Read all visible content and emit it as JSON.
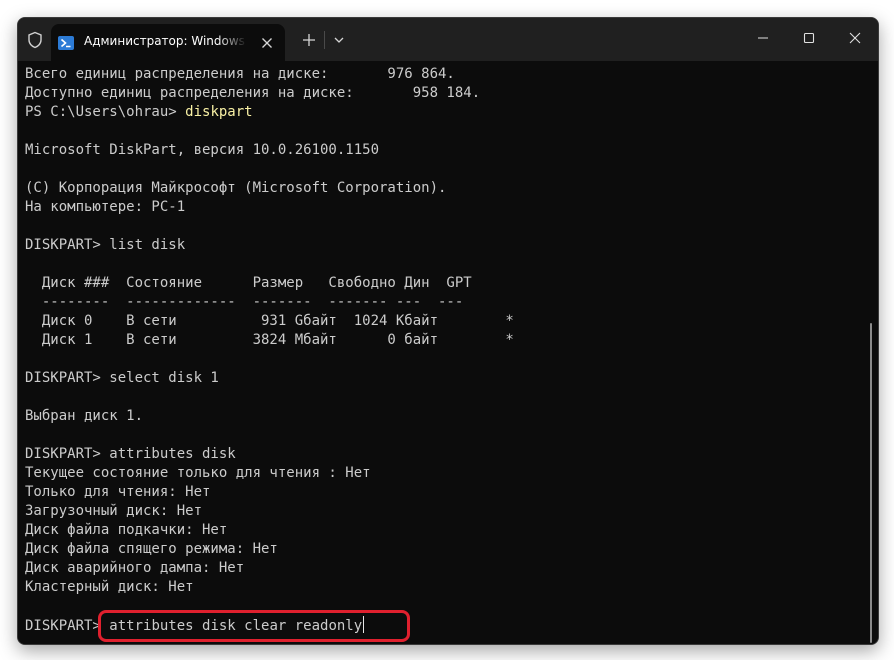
{
  "window": {
    "tab_title": "Администратор: Windows PowerShell"
  },
  "colors": {
    "console_bg": "#0c0c0c",
    "console_fg": "#cccccc",
    "command_fg": "#f9f1a5",
    "titlebar_bg": "#202020",
    "highlight": "#e0202e"
  },
  "icons": {
    "shield": "shield-icon",
    "powershell": "powershell-icon",
    "tab_close": "close-icon",
    "new_tab": "plus-icon",
    "dropdown": "chevron-down-icon",
    "minimize": "minimize-icon",
    "maximize": "maximize-icon",
    "close": "close-icon"
  },
  "console": {
    "l01": "Всего единиц распределения на диске:       976 864.",
    "l02": "Доступно единиц распределения на диске:       958 184.",
    "l03_prompt": "PS C:\\Users\\ohrau> ",
    "l03_cmd": "diskpart",
    "l04": "Microsoft DiskPart, версия 10.0.26100.1150",
    "l05": "(C) Корпорация Майкрософт (Microsoft Corporation).",
    "l06": "На компьютере: PC-1",
    "l07": "DISKPART> list disk",
    "table_header": "  Диск ###  Состояние      Размер   Свободно Дин  GPT",
    "table_rule": "  --------  -------------  -------  ------- ---  ---",
    "table_row1": "  Диск 0    В сети          931 Gбайт  1024 Кбайт        *",
    "table_row2": "  Диск 1    В сети         3824 Мбайт      0 байт        *",
    "l08": "DISKPART> select disk 1",
    "l09": "Выбран диск 1.",
    "l10": "DISKPART> attributes disk",
    "l11": "Текущее состояние только для чтения : Нет",
    "l12": "Только для чтения: Нет",
    "l13": "Загрузочный диск: Нет",
    "l14": "Диск файла подкачки: Нет",
    "l15": "Диск файла спящего режима: Нет",
    "l16": "Диск аварийного дампа: Нет",
    "l17": "Кластерный диск: Нет",
    "last_prompt": "DISKPART> ",
    "last_cmd": "attributes disk clear readonly"
  }
}
